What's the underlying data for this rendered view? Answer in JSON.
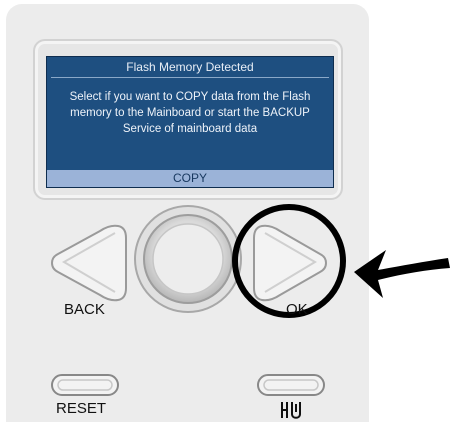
{
  "screen": {
    "title": "Flash Memory Detected",
    "message": "Select if you want to COPY data from the Flash memory to the Mainboard or start the BACKUP Service of mainboard data",
    "selected_option": "COPY"
  },
  "controls": {
    "back_label": "BACK",
    "ok_label": "OK",
    "reset_label": "RESET",
    "service_icon": "service-tools-icon",
    "knob": "rotary-knob"
  },
  "annotation": {
    "highlight": "circle-around-ok-button",
    "pointer": "curved-arrow-left"
  },
  "colors": {
    "screen_bg": "#1e4f80",
    "selection_bar": "#9bb3d8",
    "panel": "#ececec"
  }
}
